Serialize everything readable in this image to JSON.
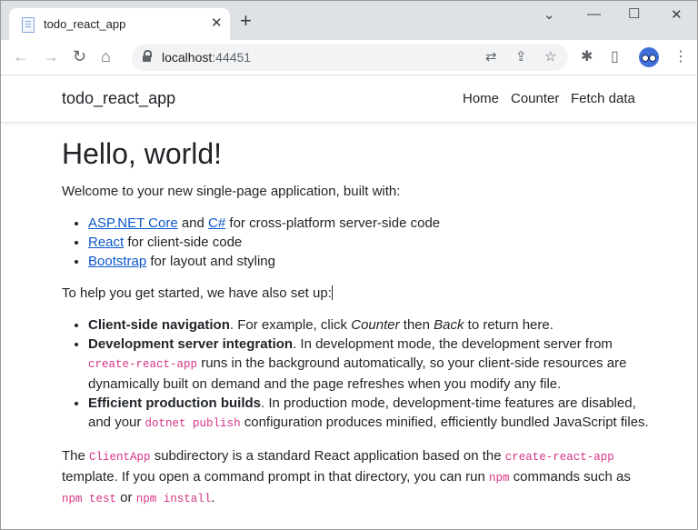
{
  "browser": {
    "tab_title": "todo_react_app",
    "new_tab_icon": "plus-icon",
    "url_host": "localhost",
    "url_port": ":44451"
  },
  "app": {
    "brand": "todo_react_app",
    "nav": [
      "Home",
      "Counter",
      "Fetch data"
    ]
  },
  "page": {
    "heading": "Hello, world!",
    "intro": "Welcome to your new single-page application, built with:",
    "stack": [
      {
        "links": [
          "ASP.NET Core",
          "C#"
        ],
        "joiner": " and ",
        "text": " for cross-platform server-side code"
      },
      {
        "links": [
          "React"
        ],
        "text": " for client-side code"
      },
      {
        "links": [
          "Bootstrap"
        ],
        "text": " for layout and styling"
      }
    ],
    "setup_intro": "To help you get started, we have also set up:",
    "features": [
      {
        "title": "Client-side navigation",
        "t1": ". For example, click ",
        "em1": "Counter",
        "t2": " then ",
        "em2": "Back",
        "t3": " to return here."
      },
      {
        "title": "Development server integration",
        "t1": ". In development mode, the development server from ",
        "code": "create-react-app",
        "t2": " runs in the background automatically, so your client-side resources are dynamically built on demand and the page refreshes when you modify any file."
      },
      {
        "title": "Efficient production builds",
        "t1": ". In production mode, development-time features are disabled, and your ",
        "code": "dotnet publish",
        "t2": " configuration produces minified, efficiently bundled JavaScript files."
      }
    ],
    "closing": {
      "t1": "The ",
      "c1": "ClientApp",
      "t2": " subdirectory is a standard React application based on the ",
      "c2": "create-react-app",
      "t3": " template. If you open a command prompt in that directory, you can run ",
      "c3": "npm",
      "t4": " commands such as ",
      "c4": "npm test",
      "t5": " or ",
      "c5": "npm install",
      "t6": "."
    }
  },
  "colors": {
    "link": "#0a58ca",
    "code": "#d63384",
    "text": "#212529"
  }
}
